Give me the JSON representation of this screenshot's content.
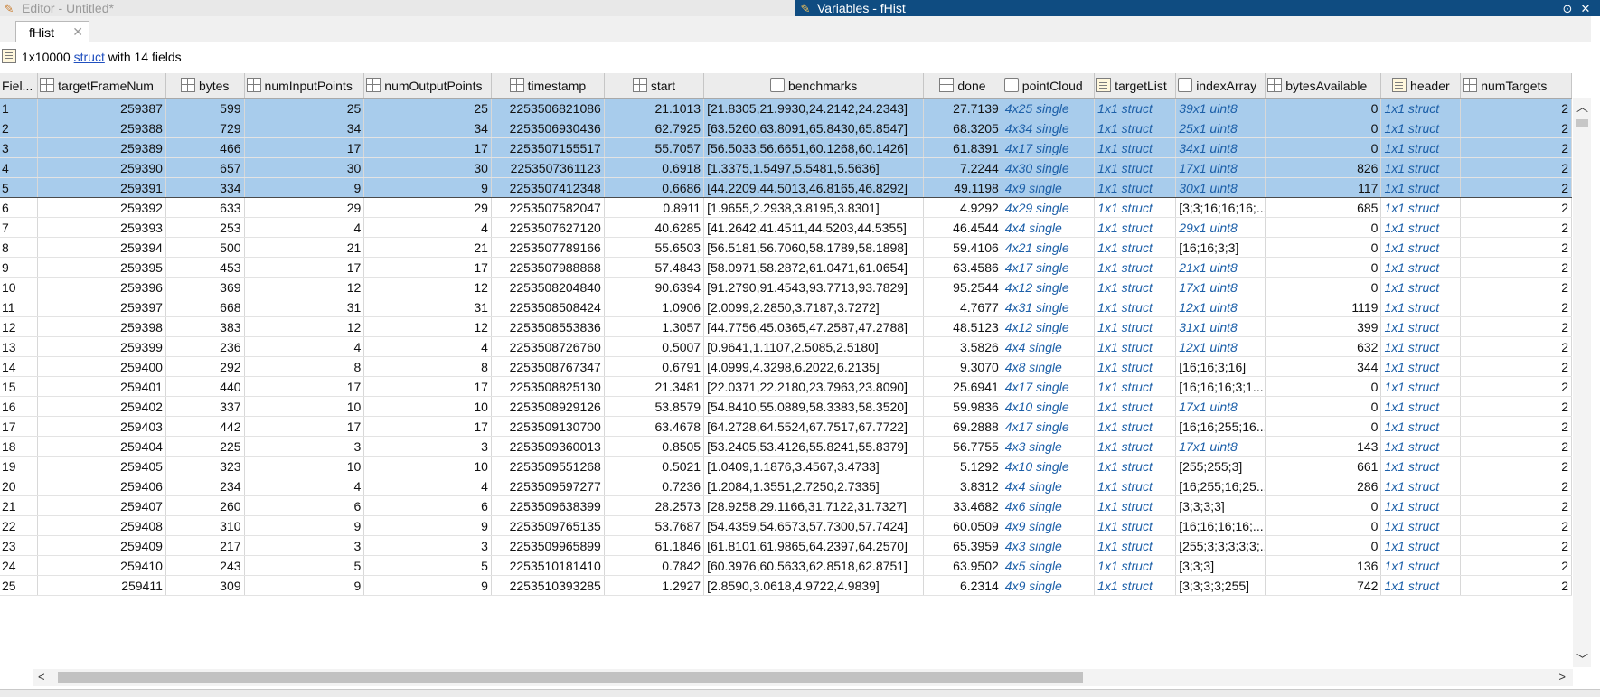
{
  "window": {
    "editor_title": "Editor - Untitled*",
    "variables_title": "Variables - fHist",
    "collapse_label": "⊙",
    "close_label": "✕"
  },
  "tab": {
    "label": "fHist",
    "close": "✕"
  },
  "info": {
    "prefix": "1x10000 ",
    "link": "struct",
    "suffix": " with 14 fields"
  },
  "columns": [
    {
      "label": "Fiel...",
      "icon": "none"
    },
    {
      "label": "targetFrameNum",
      "icon": "numeric-icon"
    },
    {
      "label": "bytes",
      "icon": "numeric-icon"
    },
    {
      "label": "numInputPoints",
      "icon": "numeric-icon"
    },
    {
      "label": "numOutputPoints",
      "icon": "numeric-icon"
    },
    {
      "label": "timestamp",
      "icon": "numeric-icon"
    },
    {
      "label": "start",
      "icon": "numeric-icon"
    },
    {
      "label": "benchmarks",
      "icon": "cell-icon"
    },
    {
      "label": "done",
      "icon": "numeric-icon"
    },
    {
      "label": "pointCloud",
      "icon": "cell-icon"
    },
    {
      "label": "targetList",
      "icon": "struct-icon"
    },
    {
      "label": "indexArray",
      "icon": "cell-icon"
    },
    {
      "label": "bytesAvailable",
      "icon": "numeric-icon"
    },
    {
      "label": "header",
      "icon": "struct-icon"
    },
    {
      "label": "numTargets",
      "icon": "numeric-icon"
    }
  ],
  "rows": [
    [
      "1",
      "259387",
      "599",
      "25",
      "25",
      "2253506821086",
      "21.1013",
      "[21.8305,21.9930,24.2142,24.2343]",
      "27.7139",
      "4x25 single",
      "1x1 struct",
      "39x1 uint8",
      "0",
      "1x1 struct",
      "2"
    ],
    [
      "2",
      "259388",
      "729",
      "34",
      "34",
      "2253506930436",
      "62.7925",
      "[63.5260,63.8091,65.8430,65.8547]",
      "68.3205",
      "4x34 single",
      "1x1 struct",
      "25x1 uint8",
      "0",
      "1x1 struct",
      "2"
    ],
    [
      "3",
      "259389",
      "466",
      "17",
      "17",
      "2253507155517",
      "55.7057",
      "[56.5033,56.6651,60.1268,60.1426]",
      "61.8391",
      "4x17 single",
      "1x1 struct",
      "34x1 uint8",
      "0",
      "1x1 struct",
      "2"
    ],
    [
      "4",
      "259390",
      "657",
      "30",
      "30",
      "2253507361123",
      "0.6918",
      "[1.3375,1.5497,5.5481,5.5636]",
      "7.2244",
      "4x30 single",
      "1x1 struct",
      "17x1 uint8",
      "826",
      "1x1 struct",
      "2"
    ],
    [
      "5",
      "259391",
      "334",
      "9",
      "9",
      "2253507412348",
      "0.6686",
      "[44.2209,44.5013,46.8165,46.8292]",
      "49.1198",
      "4x9 single",
      "1x1 struct",
      "30x1 uint8",
      "117",
      "1x1 struct",
      "2"
    ],
    [
      "6",
      "259392",
      "633",
      "29",
      "29",
      "2253507582047",
      "0.8911",
      "[1.9655,2.2938,3.8195,3.8301]",
      "4.9292",
      "4x29 single",
      "1x1 struct",
      "[3;3;16;16;16;...",
      "685",
      "1x1 struct",
      "2"
    ],
    [
      "7",
      "259393",
      "253",
      "4",
      "4",
      "2253507627120",
      "40.6285",
      "[41.2642,41.4511,44.5203,44.5355]",
      "46.4544",
      "4x4 single",
      "1x1 struct",
      "29x1 uint8",
      "0",
      "1x1 struct",
      "2"
    ],
    [
      "8",
      "259394",
      "500",
      "21",
      "21",
      "2253507789166",
      "55.6503",
      "[56.5181,56.7060,58.1789,58.1898]",
      "59.4106",
      "4x21 single",
      "1x1 struct",
      "[16;16;3;3]",
      "0",
      "1x1 struct",
      "2"
    ],
    [
      "9",
      "259395",
      "453",
      "17",
      "17",
      "2253507988868",
      "57.4843",
      "[58.0971,58.2872,61.0471,61.0654]",
      "63.4586",
      "4x17 single",
      "1x1 struct",
      "21x1 uint8",
      "0",
      "1x1 struct",
      "2"
    ],
    [
      "10",
      "259396",
      "369",
      "12",
      "12",
      "2253508204840",
      "90.6394",
      "[91.2790,91.4543,93.7713,93.7829]",
      "95.2544",
      "4x12 single",
      "1x1 struct",
      "17x1 uint8",
      "0",
      "1x1 struct",
      "2"
    ],
    [
      "11",
      "259397",
      "668",
      "31",
      "31",
      "2253508508424",
      "1.0906",
      "[2.0099,2.2850,3.7187,3.7272]",
      "4.7677",
      "4x31 single",
      "1x1 struct",
      "12x1 uint8",
      "1119",
      "1x1 struct",
      "2"
    ],
    [
      "12",
      "259398",
      "383",
      "12",
      "12",
      "2253508553836",
      "1.3057",
      "[44.7756,45.0365,47.2587,47.2788]",
      "48.5123",
      "4x12 single",
      "1x1 struct",
      "31x1 uint8",
      "399",
      "1x1 struct",
      "2"
    ],
    [
      "13",
      "259399",
      "236",
      "4",
      "4",
      "2253508726760",
      "0.5007",
      "[0.9641,1.1107,2.5085,2.5180]",
      "3.5826",
      "4x4 single",
      "1x1 struct",
      "12x1 uint8",
      "632",
      "1x1 struct",
      "2"
    ],
    [
      "14",
      "259400",
      "292",
      "8",
      "8",
      "2253508767347",
      "0.6791",
      "[4.0999,4.3298,6.2022,6.2135]",
      "9.3070",
      "4x8 single",
      "1x1 struct",
      "[16;16;3;16]",
      "344",
      "1x1 struct",
      "2"
    ],
    [
      "15",
      "259401",
      "440",
      "17",
      "17",
      "2253508825130",
      "21.3481",
      "[22.0371,22.2180,23.7963,23.8090]",
      "25.6941",
      "4x17 single",
      "1x1 struct",
      "[16;16;16;3;1...",
      "0",
      "1x1 struct",
      "2"
    ],
    [
      "16",
      "259402",
      "337",
      "10",
      "10",
      "2253508929126",
      "53.8579",
      "[54.8410,55.0889,58.3383,58.3520]",
      "59.9836",
      "4x10 single",
      "1x1 struct",
      "17x1 uint8",
      "0",
      "1x1 struct",
      "2"
    ],
    [
      "17",
      "259403",
      "442",
      "17",
      "17",
      "2253509130700",
      "63.4678",
      "[64.2728,64.5524,67.7517,67.7722]",
      "69.2888",
      "4x17 single",
      "1x1 struct",
      "[16;16;255;16...",
      "0",
      "1x1 struct",
      "2"
    ],
    [
      "18",
      "259404",
      "225",
      "3",
      "3",
      "2253509360013",
      "0.8505",
      "[53.2405,53.4126,55.8241,55.8379]",
      "56.7755",
      "4x3 single",
      "1x1 struct",
      "17x1 uint8",
      "143",
      "1x1 struct",
      "2"
    ],
    [
      "19",
      "259405",
      "323",
      "10",
      "10",
      "2253509551268",
      "0.5021",
      "[1.0409,1.1876,3.4567,3.4733]",
      "5.1292",
      "4x10 single",
      "1x1 struct",
      "[255;255;3]",
      "661",
      "1x1 struct",
      "2"
    ],
    [
      "20",
      "259406",
      "234",
      "4",
      "4",
      "2253509597277",
      "0.7236",
      "[1.2084,1.3551,2.7250,2.7335]",
      "3.8312",
      "4x4 single",
      "1x1 struct",
      "[16;255;16;25...",
      "286",
      "1x1 struct",
      "2"
    ],
    [
      "21",
      "259407",
      "260",
      "6",
      "6",
      "2253509638399",
      "28.2573",
      "[28.9258,29.1166,31.7122,31.7327]",
      "33.4682",
      "4x6 single",
      "1x1 struct",
      "[3;3;3;3]",
      "0",
      "1x1 struct",
      "2"
    ],
    [
      "22",
      "259408",
      "310",
      "9",
      "9",
      "2253509765135",
      "53.7687",
      "[54.4359,54.6573,57.7300,57.7424]",
      "60.0509",
      "4x9 single",
      "1x1 struct",
      "[16;16;16;16;...",
      "0",
      "1x1 struct",
      "2"
    ],
    [
      "23",
      "259409",
      "217",
      "3",
      "3",
      "2253509965899",
      "61.1846",
      "[61.8101,61.9865,64.2397,64.2570]",
      "65.3959",
      "4x3 single",
      "1x1 struct",
      "[255;3;3;3;3;3;...",
      "0",
      "1x1 struct",
      "2"
    ],
    [
      "24",
      "259410",
      "243",
      "5",
      "5",
      "2253510181410",
      "0.7842",
      "[60.3976,60.5633,62.8518,62.8751]",
      "63.9502",
      "4x5 single",
      "1x1 struct",
      "[3;3;3]",
      "136",
      "1x1 struct",
      "2"
    ],
    [
      "25",
      "259411",
      "309",
      "9",
      "9",
      "2253510393285",
      "1.2927",
      "[2.8590,3.0618,4.9722,4.9839]",
      "6.2314",
      "4x9 single",
      "1x1 struct",
      "[3;3;3;3;255]",
      "742",
      "1x1 struct",
      "2"
    ]
  ],
  "selected_rows": 5,
  "scroll": {
    "up": "︿",
    "down": "﹀",
    "left": "<",
    "right": ">"
  }
}
